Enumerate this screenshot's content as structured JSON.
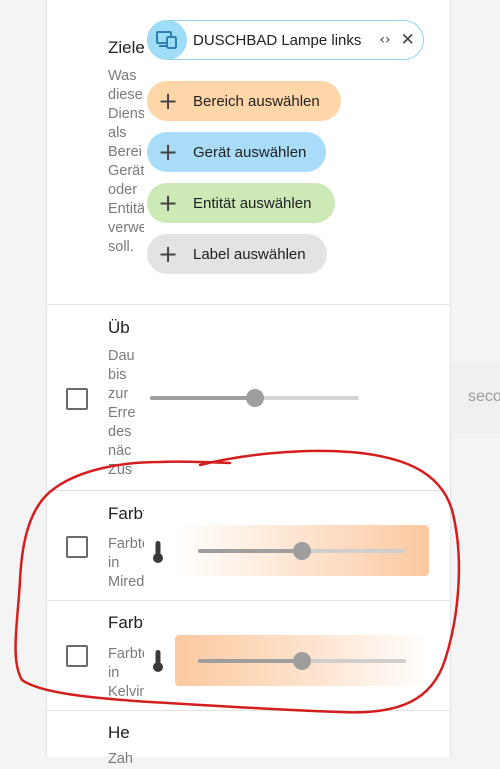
{
  "targets": {
    "title": "Ziele",
    "description": "Was\ndiese\nDiens\nals\nBerei\nGerät\noder\nEntitä\nverwe\nsoll.",
    "device_chip": {
      "label": "DUSCHBAD Lampe links",
      "expand_symbol": "‹›",
      "close_symbol": "✕",
      "icon": "device-icon"
    },
    "add_buttons": [
      {
        "label": "Bereich auswählen",
        "color": "#ffd6a8"
      },
      {
        "label": "Gerät auswählen",
        "color": "#a8dcf8"
      },
      {
        "label": "Entität auswählen",
        "color": "#cde9b6"
      },
      {
        "label": "Label auswählen",
        "color": "#e3e3e3"
      }
    ]
  },
  "transition": {
    "title": "Üb",
    "description": "Dau\nbis\nzur\nErre\ndes\nnäc\nZus",
    "slider_value": 0.5,
    "unit": "seco"
  },
  "color_temp_mired": {
    "title": "Farbt",
    "description": "Farbte\nin\nMired",
    "slider_value": 0.5,
    "icon": "thermometer-icon"
  },
  "color_temp_kelvin": {
    "title": "Farbt",
    "description": "Farbte\nin\nKelvin",
    "slider_value": 0.5,
    "icon": "thermometer-icon"
  },
  "brightness": {
    "title": "He",
    "description": "Zah"
  },
  "colors": {
    "accent_orange": "#fcc9a0",
    "annotation_red": "#d41e1e"
  }
}
